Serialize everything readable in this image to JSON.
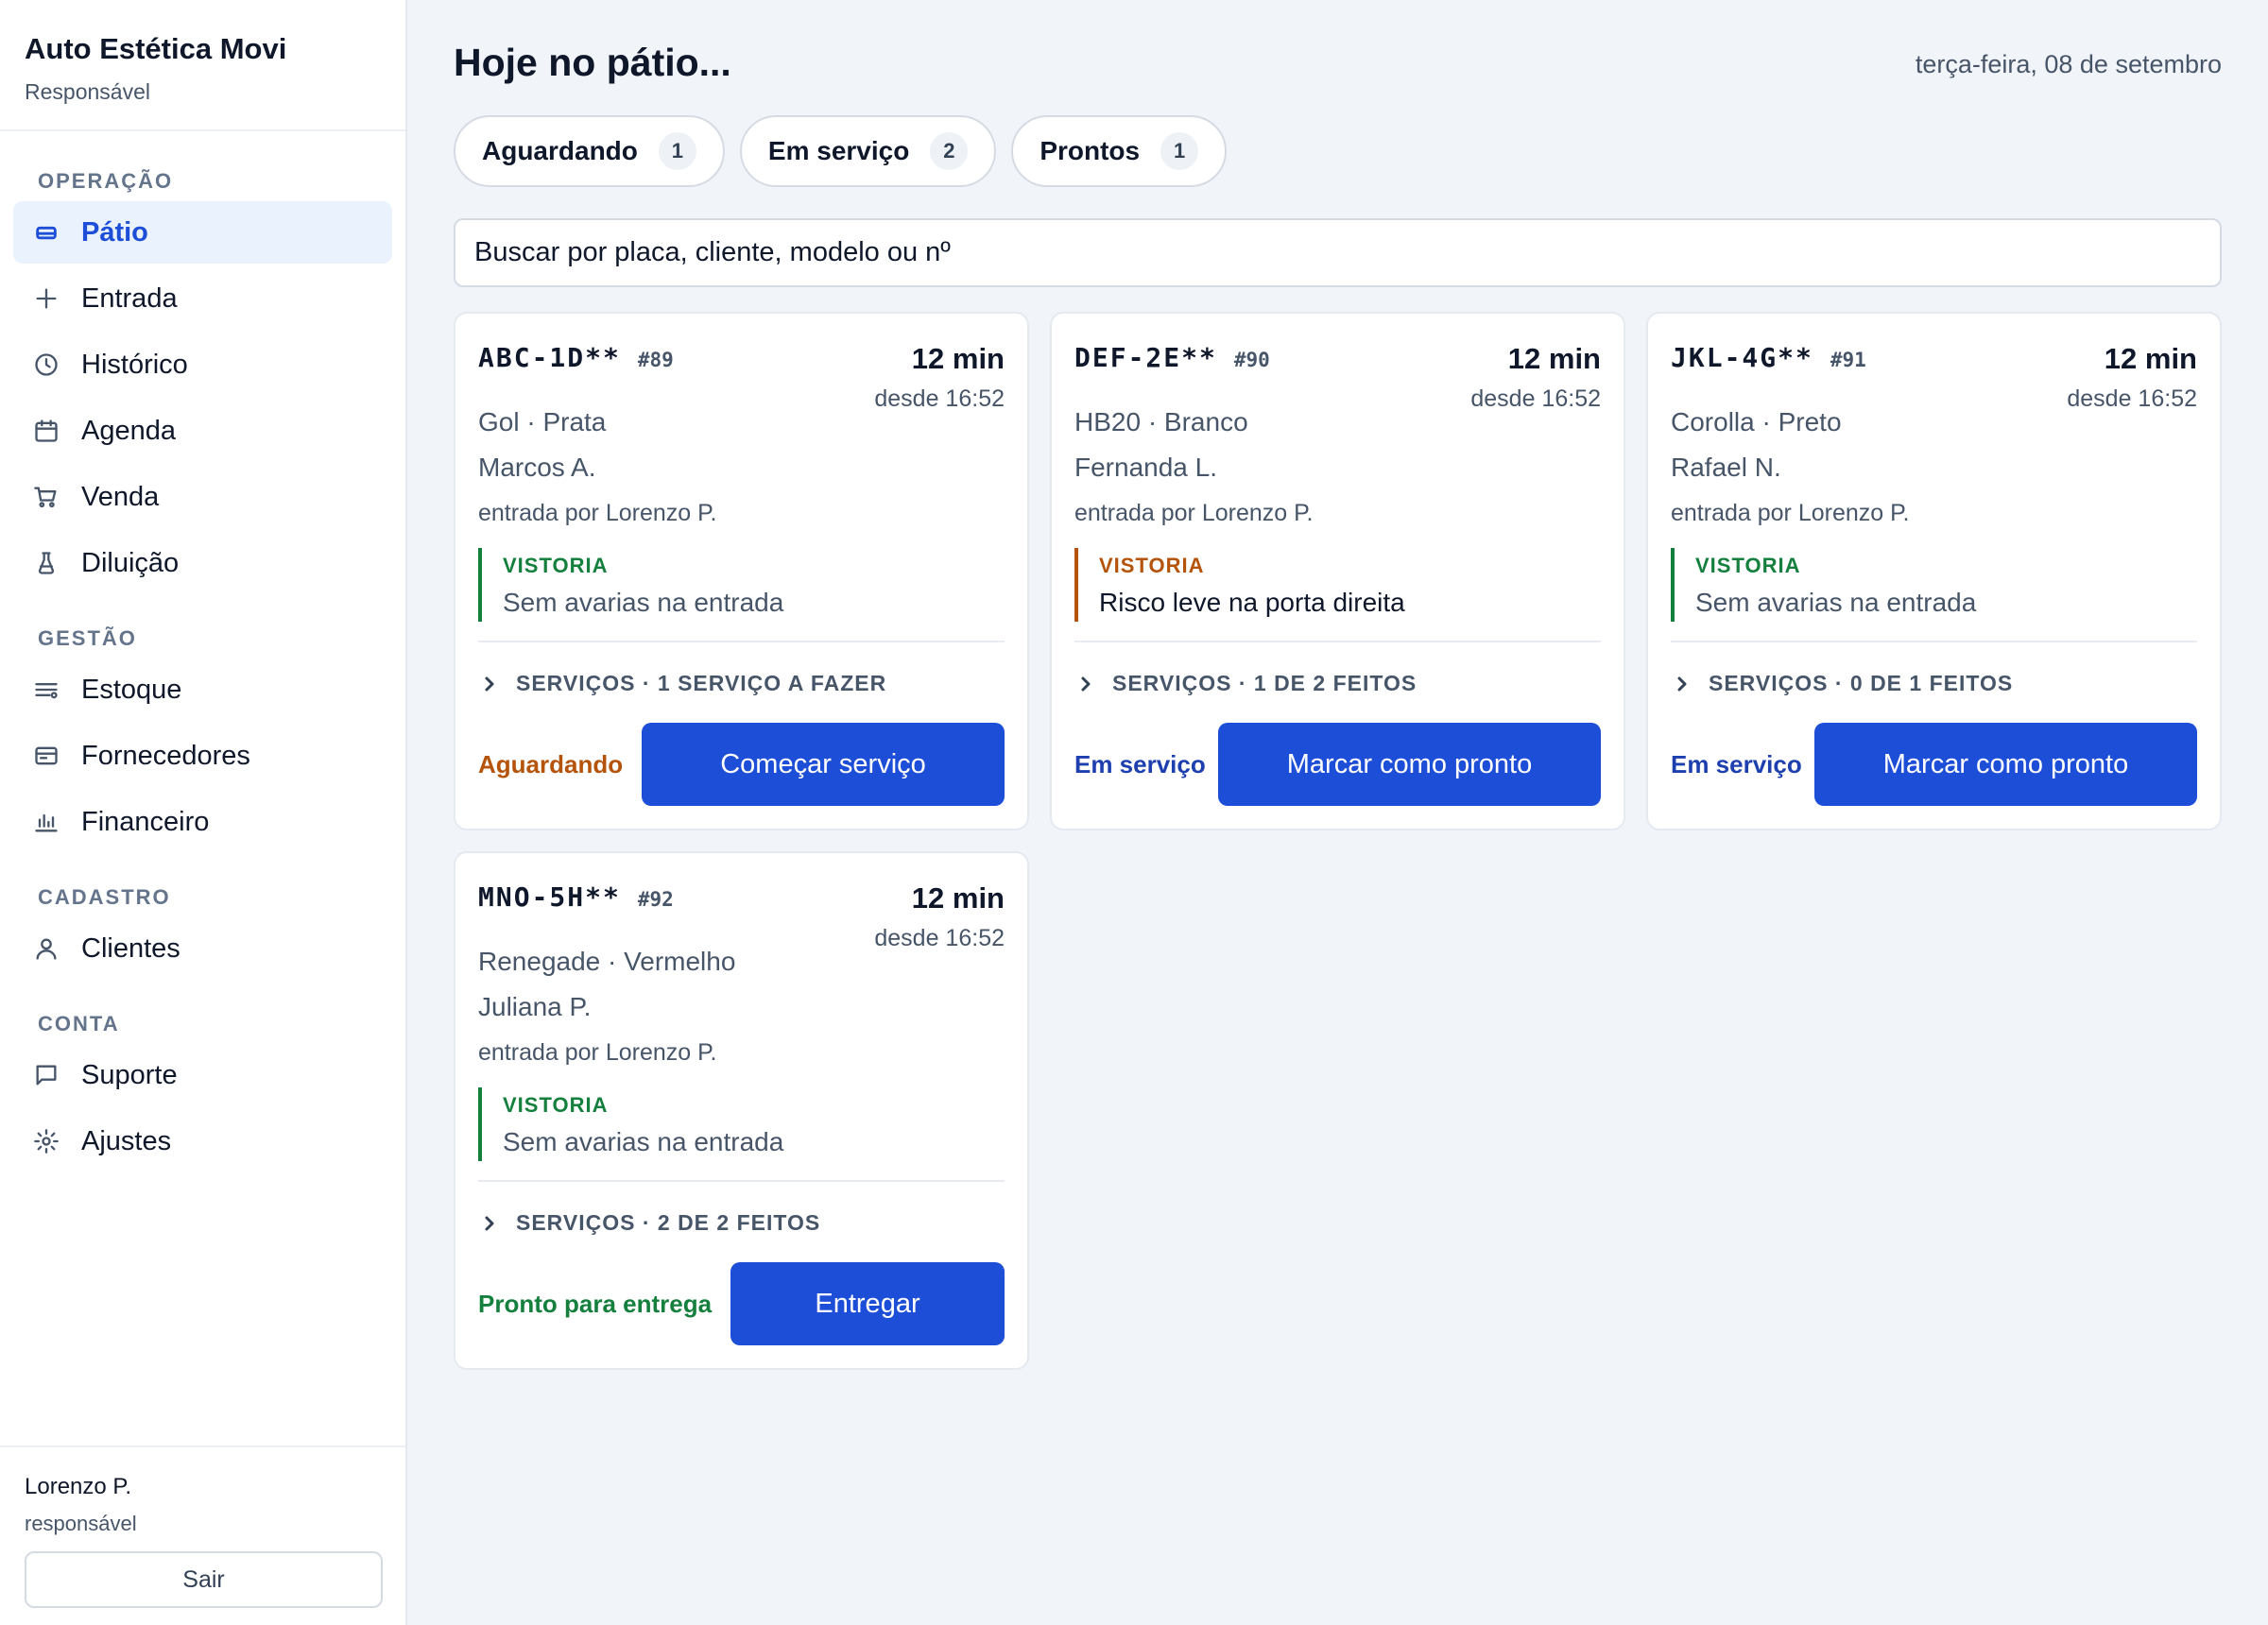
{
  "brand": {
    "title": "Auto Estética Movi",
    "subtitle": "Responsável"
  },
  "sidebar": {
    "sections": {
      "operacao": "OPERAÇÃO",
      "gestao": "GESTÃO",
      "cadastro": "CADASTRO",
      "conta": "CONTA"
    },
    "items": {
      "patio": "Pátio",
      "entrada": "Entrada",
      "historico": "Histórico",
      "agenda": "Agenda",
      "venda": "Venda",
      "diluicao": "Diluição",
      "estoque": "Estoque",
      "fornecedores": "Fornecedores",
      "financeiro": "Financeiro",
      "clientes": "Clientes",
      "suporte": "Suporte",
      "ajustes": "Ajustes"
    },
    "active": "patio"
  },
  "user": {
    "name": "Lorenzo P.",
    "role": "responsável",
    "logout_label": "Sair"
  },
  "header": {
    "title": "Hoje no pátio...",
    "date": "terça-feira, 08 de setembro"
  },
  "filters": [
    {
      "label": "Aguardando",
      "count": "1"
    },
    {
      "label": "Em serviço",
      "count": "2"
    },
    {
      "label": "Prontos",
      "count": "1"
    }
  ],
  "search": {
    "placeholder": "Buscar por placa, cliente, modelo ou nº"
  },
  "cards": [
    {
      "plate": "ABC-1D**",
      "number": "#89",
      "elapsed": "12 min",
      "since": "desde 16:52",
      "model": "Gol · Prata",
      "client": "Marcos A.",
      "entry": "entrada por Lorenzo P.",
      "inspection_label": "VISTORIA",
      "inspection_text": "Sem avarias na entrada",
      "services": "SERVIÇOS · 1 SERVIÇO A FAZER",
      "status": "Aguardando",
      "action": "Começar serviço"
    },
    {
      "plate": "DEF-2E**",
      "number": "#90",
      "elapsed": "12 min",
      "since": "desde 16:52",
      "model": "HB20 · Branco",
      "client": "Fernanda L.",
      "entry": "entrada por Lorenzo P.",
      "inspection_label": "VISTORIA",
      "inspection_text": "Risco leve na porta direita",
      "services": "SERVIÇOS · 1 DE 2 FEITOS",
      "status": "Em serviço",
      "action": "Marcar como pronto"
    },
    {
      "plate": "JKL-4G**",
      "number": "#91",
      "elapsed": "12 min",
      "since": "desde 16:52",
      "model": "Corolla · Preto",
      "client": "Rafael N.",
      "entry": "entrada por Lorenzo P.",
      "inspection_label": "VISTORIA",
      "inspection_text": "Sem avarias na entrada",
      "services": "SERVIÇOS · 0 DE 1 FEITOS",
      "status": "Em serviço",
      "action": "Marcar como pronto"
    },
    {
      "plate": "MNO-5H**",
      "number": "#92",
      "elapsed": "12 min",
      "since": "desde 16:52",
      "model": "Renegade · Vermelho",
      "client": "Juliana P.",
      "entry": "entrada por Lorenzo P.",
      "inspection_label": "VISTORIA",
      "inspection_text": "Sem avarias na entrada",
      "services": "SERVIÇOS · 2 DE 2 FEITOS",
      "status": "Pronto para entrega",
      "action": "Entregar"
    }
  ],
  "colors": {
    "accent": "#1d4ed8",
    "waiting": "#b45309",
    "in_service": "#1e40af",
    "ready": "#15803d"
  }
}
